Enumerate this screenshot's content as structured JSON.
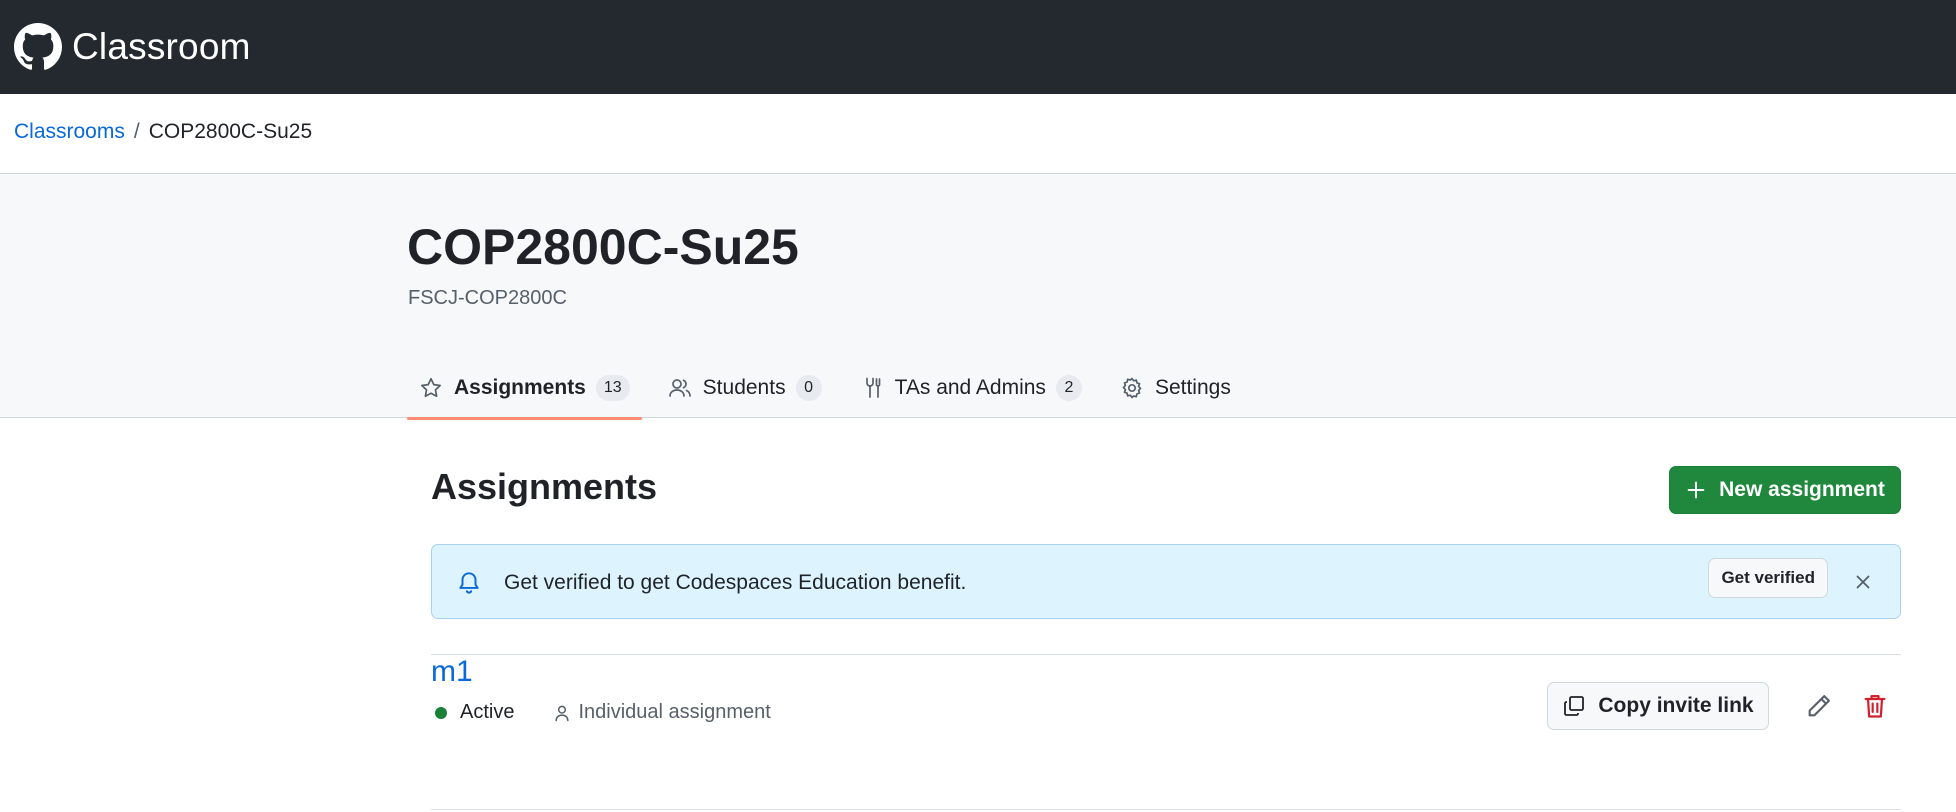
{
  "header": {
    "app_title": "Classroom",
    "logo_icon": "github-logo-icon"
  },
  "breadcrumb": {
    "root": "Classrooms",
    "separator": "/",
    "current": "COP2800C-Su25"
  },
  "classroom": {
    "title": "COP2800C-Su25",
    "organization": "FSCJ-COP2800C"
  },
  "tabs": [
    {
      "label": "Assignments",
      "count": "13",
      "icon": "star-icon",
      "selected": true
    },
    {
      "label": "Students",
      "count": "0",
      "icon": "people-icon",
      "selected": false
    },
    {
      "label": "TAs and Admins",
      "count": "2",
      "icon": "tools-icon",
      "selected": false
    },
    {
      "label": "Settings",
      "icon": "gear-icon",
      "selected": false
    }
  ],
  "assignments_section": {
    "title": "Assignments",
    "new_button_label": "New assignment"
  },
  "banner": {
    "text": "Get verified to get Codespaces Education benefit.",
    "button_label": "Get verified"
  },
  "assignments": [
    {
      "name": "m1",
      "status": "Active",
      "type": "Individual assignment",
      "copy_label": "Copy invite link"
    }
  ],
  "colors": {
    "topbar": "#24292f",
    "link": "#0969da",
    "primary_button": "#1f883d",
    "tab_underline": "#fd8c73",
    "banner_bg": "#ddf4ff",
    "status_active": "#1a7f37",
    "danger": "#cf222e"
  }
}
